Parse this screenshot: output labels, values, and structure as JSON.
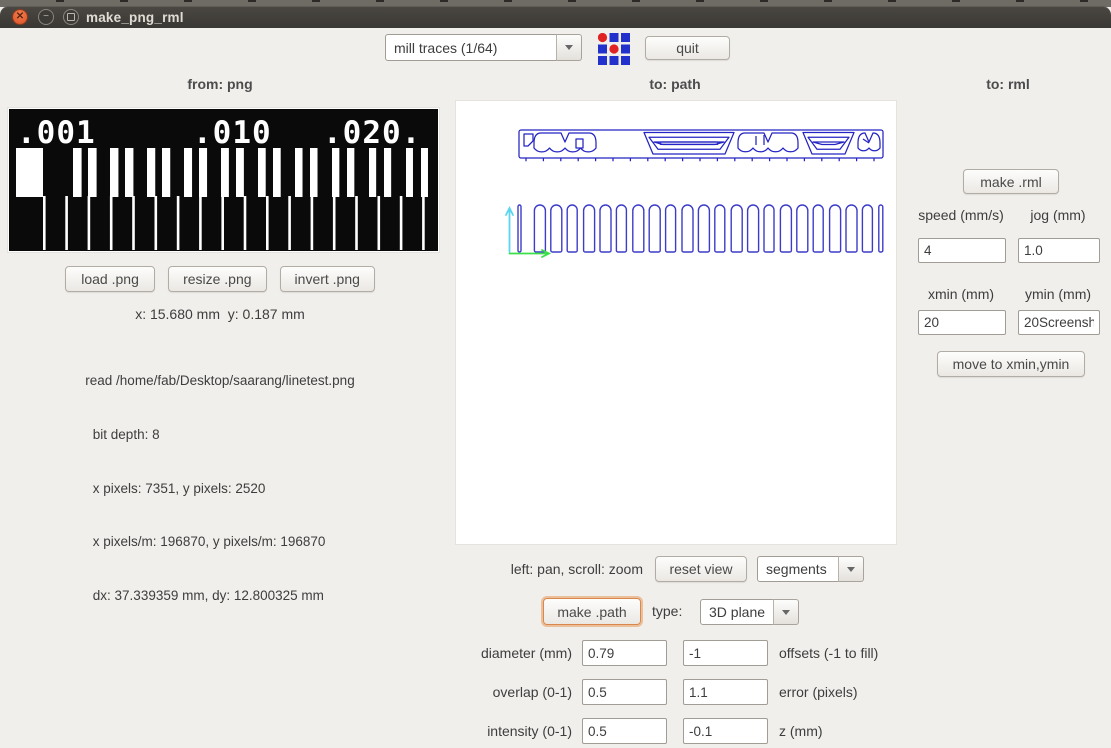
{
  "window": {
    "title": "make_png_rml"
  },
  "toolbar": {
    "process_select": "mill traces (1/64)",
    "quit_label": "quit"
  },
  "columns": {
    "png_header": "from: png",
    "path_header": "to: path",
    "rml_header": "to: rml"
  },
  "png": {
    "image_labels": [
      ".001",
      ".010",
      ".020."
    ],
    "load_label": "load .png",
    "resize_label": "resize .png",
    "invert_label": "invert .png",
    "coords": "x: 15.680 mm  y: 0.187 mm",
    "info_lines": [
      "read /home/fab/Desktop/saarang/linetest.png",
      "  bit depth: 8",
      "  x pixels: 7351, y pixels: 2520",
      "  x pixels/m: 196870, y pixels/m: 196870",
      "  dx: 37.339359 mm, dy: 12.800325 mm"
    ]
  },
  "path": {
    "hint": "left: pan, scroll: zoom",
    "reset_label": "reset view",
    "view_select": "segments",
    "make_label": "make .path",
    "type_label": "type:",
    "type_select": "3D plane",
    "rows": [
      {
        "label": "diameter (mm)",
        "value1": "0.79",
        "value2": "-1",
        "label2": "offsets (-1 to fill)"
      },
      {
        "label": "overlap (0-1)",
        "value1": "0.5",
        "value2": "1.1",
        "label2": "error (pixels)"
      },
      {
        "label": "intensity (0-1)",
        "value1": "0.5",
        "value2": "-0.1",
        "label2": "z (mm)"
      }
    ]
  },
  "rml": {
    "make_label": "make .rml",
    "speed_label": "speed (mm/s)",
    "jog_label": "jog (mm)",
    "speed_value": "4",
    "jog_value": "1.0",
    "xmin_label": "xmin (mm)",
    "ymin_label": "ymin (mm)",
    "xmin_value": "20",
    "ymin_value": "20Screensh",
    "move_label": "move to xmin,ymin"
  },
  "graphics": {
    "slot_count": 23,
    "bar_pair_count": 10,
    "line_count": 18,
    "tick_count": 21
  },
  "colors": {
    "path_blue": "#2424c4",
    "slot_blue": "#3c3cc8",
    "axis_cyan": "#5cd6f0",
    "axis_green": "#3bdf47",
    "logo_blue": "#2230cc",
    "logo_red": "#e02222",
    "focus_orange": "#e2945c",
    "close_orange": "#dc4f24"
  }
}
